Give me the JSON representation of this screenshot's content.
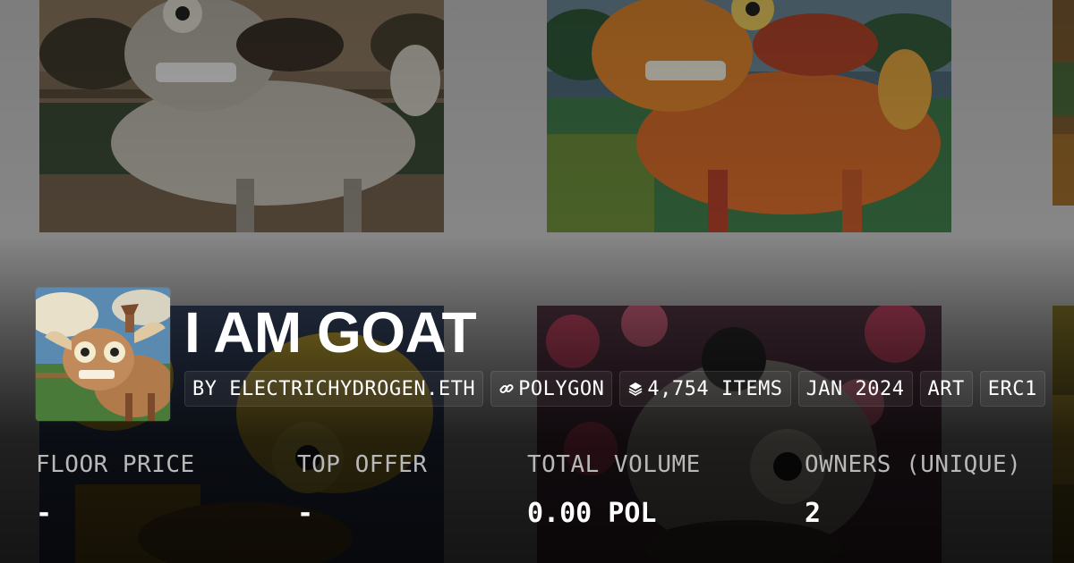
{
  "collection": {
    "title": "I AM GOAT",
    "creator": "BY ELECTRICHYDROGEN.ETH",
    "chain": "POLYGON",
    "items": "4,754 ITEMS",
    "created": "JAN 2024",
    "category": "ART",
    "standard": "ERC1"
  },
  "stats": [
    {
      "label": "FLOOR PRICE",
      "value": "-"
    },
    {
      "label": "TOP OFFER",
      "value": "-"
    },
    {
      "label": "TOTAL VOLUME",
      "value": "0.00 POL"
    },
    {
      "label": "OWNERS (UNIQUE)",
      "value": "2"
    }
  ],
  "icons": {
    "chain": "link-icon",
    "items": "layers-icon"
  },
  "colors": {
    "background": "#2a2a2a",
    "label": "#b8b8b8",
    "text": "#ffffff"
  }
}
